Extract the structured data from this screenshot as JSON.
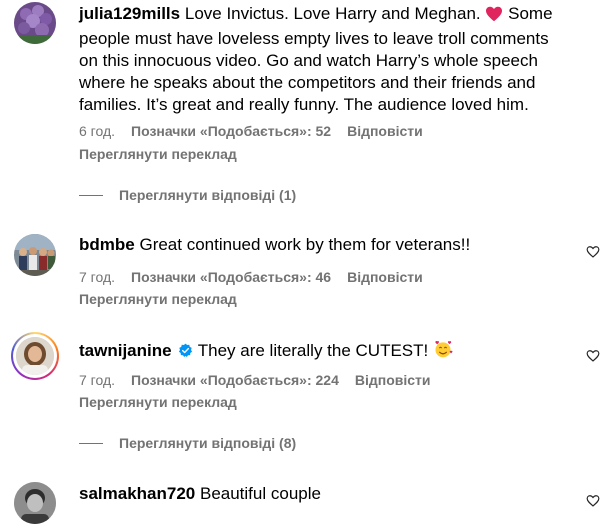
{
  "comments": [
    {
      "username": "julia129mills",
      "text_before_emoji": "Love Invictus. Love Harry and Meghan.",
      "emoji": "red-heart",
      "text_after_emoji": "Some people must have loveless empty lives to leave troll comments on this innocuous video. Go and watch Harry’s whole speech where he speaks about the competitors and their friends and families. It’s great and really funny. The audience loved him.",
      "time": "6 год.",
      "likes": "Позначки «Подобається»: 52",
      "reply": "Відповісти",
      "translate": "Переглянути переклад",
      "view_replies": "Переглянути відповіді (1)"
    },
    {
      "username": "bdmbe",
      "text": "Great continued work by them for veterans!!",
      "time": "7 год.",
      "likes": "Позначки «Подобається»: 46",
      "reply": "Відповісти",
      "translate": "Переглянути переклад"
    },
    {
      "username": "tawnijanine",
      "verified": true,
      "text": "They are literally the CUTEST!",
      "emoji": "smiling-face-with-hearts",
      "time": "7 год.",
      "likes": "Позначки «Подобається»: 224",
      "reply": "Відповісти",
      "translate": "Переглянути переклад",
      "view_replies": "Переглянути відповіді (8)"
    },
    {
      "username": "salmakhan720",
      "text": "Beautiful couple"
    }
  ],
  "colors": {
    "text": "#000000",
    "secondary": "#737373",
    "verified": "#0095f6",
    "heart_emoji": "#e0245e"
  },
  "icons": {
    "like_button": "heart-outline-icon",
    "verified_badge": "verified-badge-icon"
  }
}
